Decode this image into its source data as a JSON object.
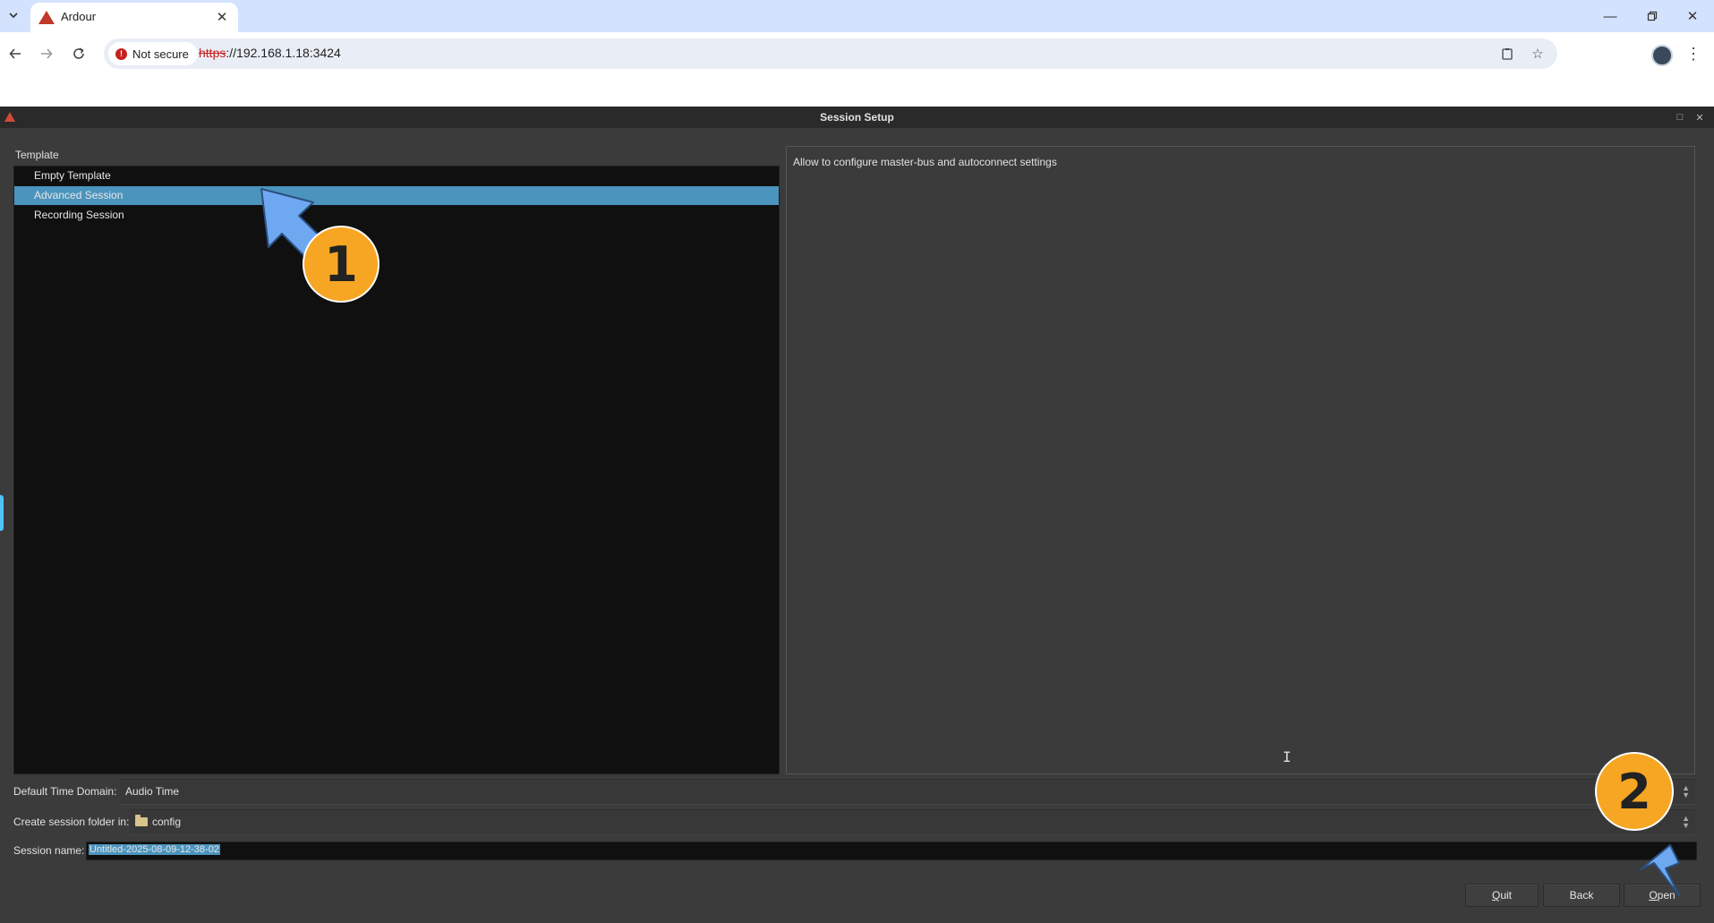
{
  "browser": {
    "tab_title": "Ardour",
    "security_label": "Not secure",
    "url_scheme": "https",
    "url_rest": "://192.168.1.18:3424"
  },
  "window": {
    "title": "Session Setup"
  },
  "template": {
    "label": "Template",
    "items": [
      {
        "label": "Empty Template",
        "selected": false
      },
      {
        "label": "Advanced Session",
        "selected": true
      },
      {
        "label": "Recording Session",
        "selected": false
      }
    ],
    "description": "Allow to configure master-bus and autoconnect settings"
  },
  "settings": {
    "time_domain_label": "Default Time Domain:",
    "time_domain_value": "Audio Time",
    "folder_label": "Create session folder in:",
    "folder_value": "config",
    "name_label": "Session name:",
    "name_value": "Untitled-2025-08-09-12-38-02"
  },
  "buttons": {
    "quit_mnemonic": "Q",
    "quit_rest": "uit",
    "back_label": "Back",
    "open_mnemonic": "O",
    "open_rest": "pen"
  },
  "annotations": {
    "step1": "1",
    "step2": "2",
    "badge_color": "#f6a623",
    "arrow_color": "#6ea8f0"
  }
}
